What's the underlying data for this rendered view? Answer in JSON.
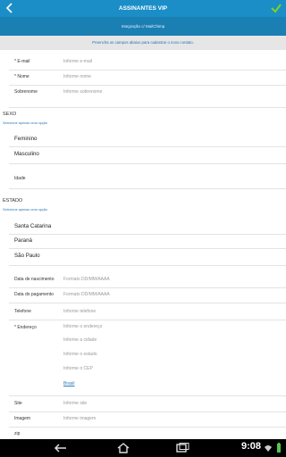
{
  "header": {
    "title": "ASSINANTES VIP",
    "subtitle": "Integração c/ MailChimp",
    "notice": "Preencha os campos abaixo para cadastrar o novo contato."
  },
  "fields": {
    "email": {
      "label": "* E-mail",
      "placeholder": "Informe e-mail"
    },
    "nome": {
      "label": "* Nome",
      "placeholder": "Informe nome"
    },
    "sobrenome": {
      "label": "Sobrenome",
      "placeholder": "Informe sobrenome"
    },
    "idade": {
      "label": "Idade"
    },
    "nascimento": {
      "label": "Data de nascimento",
      "placeholder": "Formato DD/MM/AAAA"
    },
    "pagamento": {
      "label": "Data do pagamento",
      "placeholder": "Formato DD/MM/AAAA"
    },
    "telefone": {
      "label": "Telefone",
      "placeholder": "Informe telefone"
    },
    "endereco": {
      "label": "* Endereço",
      "placeholders": [
        "Informe o endereço",
        "Informe a cidade",
        "Informe o estado",
        "Informe o CEP"
      ],
      "country": "Brasil"
    },
    "site": {
      "label": "Site",
      "placeholder": "Informe site"
    },
    "imagem": {
      "label": "Imagem",
      "placeholder": "Informe imagem"
    },
    "zip": {
      "label": "zip"
    }
  },
  "sexo": {
    "title": "SEXO",
    "help": "Selecione apenas uma opção",
    "options": [
      "Feminino",
      "Masculino"
    ]
  },
  "estado": {
    "title": "ESTADO",
    "help": "Selecione apenas uma opção",
    "options": [
      "Santa Catarina",
      "Paraná",
      "São Paulo"
    ]
  },
  "system": {
    "clock": "9:08"
  },
  "colors": {
    "topbar": "#1b8ec7",
    "subbar": "#1a7fb3",
    "accent_check": "#7ed321"
  },
  "icons": [
    "back-arrow-icon",
    "checkmark-icon",
    "nav-back-icon",
    "nav-home-icon",
    "nav-recents-icon",
    "wifi-icon",
    "battery-icon"
  ]
}
